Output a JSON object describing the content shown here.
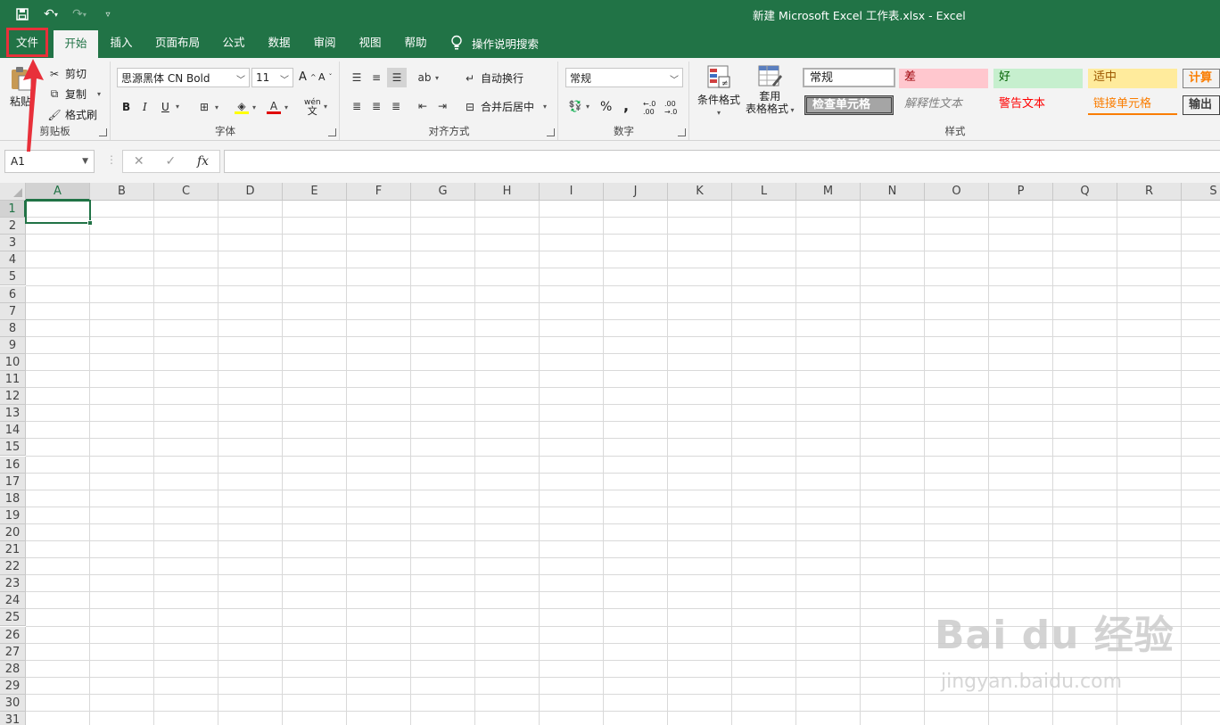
{
  "title_bar": {
    "title": "新建 Microsoft Excel 工作表.xlsx  -  Excel"
  },
  "tabs": [
    {
      "label": "文件"
    },
    {
      "label": "开始"
    },
    {
      "label": "插入"
    },
    {
      "label": "页面布局"
    },
    {
      "label": "公式"
    },
    {
      "label": "数据"
    },
    {
      "label": "审阅"
    },
    {
      "label": "视图"
    },
    {
      "label": "帮助"
    }
  ],
  "active_tab": "开始",
  "tell_me": "操作说明搜索",
  "clipboard": {
    "paste": "粘贴",
    "cut": "剪切",
    "copy": "复制",
    "format_painter": "格式刷",
    "label": "剪贴板"
  },
  "font": {
    "name": "思源黑体 CN Bold",
    "size": "11",
    "bold": "B",
    "italic": "I",
    "underline": "U",
    "label": "字体"
  },
  "alignment": {
    "wrap": "自动换行",
    "merge": "合并后居中",
    "label": "对齐方式"
  },
  "number": {
    "format": "常规",
    "percent": "%",
    "comma": ",",
    "label": "数字"
  },
  "styles_group": {
    "conditional": "条件格式",
    "table_line1": "套用",
    "table_line2": "表格格式",
    "label": "样式",
    "cells": [
      {
        "text": "常规"
      },
      {
        "text": "差"
      },
      {
        "text": "好"
      },
      {
        "text": "适中"
      },
      {
        "text": "计算"
      },
      {
        "text": "检查单元格"
      },
      {
        "text": "解释性文本"
      },
      {
        "text": "警告文本"
      },
      {
        "text": "链接单元格"
      },
      {
        "text": "输出"
      }
    ]
  },
  "formula_bar": {
    "name_box": "A1",
    "fx": "fx"
  },
  "columns": [
    "A",
    "B",
    "C",
    "D",
    "E",
    "F",
    "G",
    "H",
    "I",
    "J",
    "K",
    "L",
    "M",
    "N",
    "O",
    "P",
    "Q",
    "R",
    "S"
  ],
  "rows": [
    "1",
    "2",
    "3",
    "4",
    "5",
    "6",
    "7",
    "8",
    "9",
    "10",
    "11",
    "12",
    "13",
    "14",
    "15",
    "16",
    "17",
    "18",
    "19",
    "20",
    "21",
    "22",
    "23",
    "24",
    "25",
    "26",
    "27",
    "28",
    "29",
    "30",
    "31"
  ],
  "selected_cell": "A1",
  "accent_color": "#217346",
  "annotation_color": "#e8303a",
  "watermark": {
    "main": "Bai  du 经验",
    "sub": "jingyan.baidu.com"
  }
}
